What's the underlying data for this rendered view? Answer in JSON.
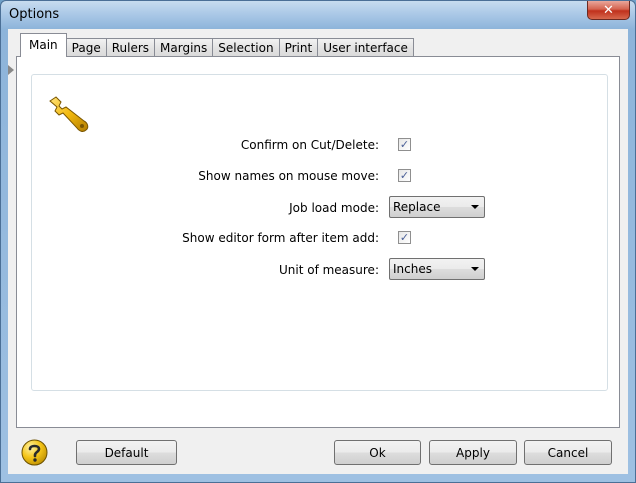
{
  "window": {
    "title": "Options",
    "close_glyph": "✕"
  },
  "tabs": [
    {
      "label": "Main",
      "active": true
    },
    {
      "label": "Page"
    },
    {
      "label": "Rulers"
    },
    {
      "label": "Margins"
    },
    {
      "label": "Selection"
    },
    {
      "label": "Print"
    },
    {
      "label": "User interface"
    }
  ],
  "main": {
    "icon": "wrench-icon",
    "confirm_cut_delete": {
      "label": "Confirm on Cut/Delete:",
      "checked": true
    },
    "show_names_mouse": {
      "label": "Show names on mouse move:",
      "checked": true
    },
    "job_load_mode": {
      "label": "Job load mode:",
      "value": "Replace"
    },
    "show_editor_form": {
      "label": "Show editor form after item add:",
      "checked": true
    },
    "unit_of_measure": {
      "label": "Unit of measure:",
      "value": "Inches"
    }
  },
  "buttons": {
    "default": "Default",
    "ok": "Ok",
    "apply": "Apply",
    "cancel": "Cancel"
  },
  "colors": {
    "titlebar": "#a9c7e6",
    "close": "#c0311c",
    "icon_yellow": "#f2b90f"
  }
}
